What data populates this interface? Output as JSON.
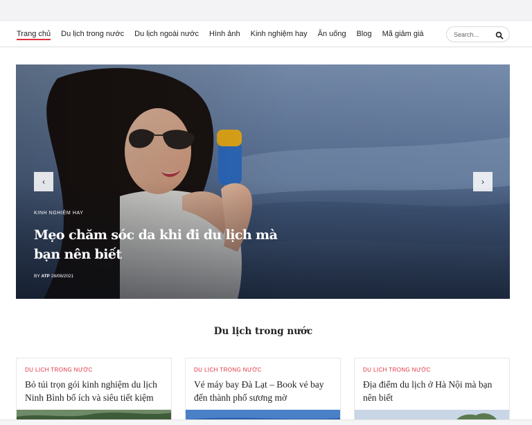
{
  "nav": {
    "items": [
      {
        "label": "Trang chủ",
        "active": true
      },
      {
        "label": "Du lịch trong nước",
        "active": false
      },
      {
        "label": "Du lịch ngoài nước",
        "active": false
      },
      {
        "label": "Hình ảnh",
        "active": false
      },
      {
        "label": "Kinh nghiệm hay",
        "active": false
      },
      {
        "label": "Ăn uống",
        "active": false
      },
      {
        "label": "Blog",
        "active": false
      },
      {
        "label": "Mã giảm giá",
        "active": false
      }
    ],
    "search_placeholder": "Search...",
    "search_icon": "search-icon"
  },
  "hero": {
    "category": "Kinh nghiệm hay",
    "title": "Mẹo chăm sóc da khi đi du lịch mà bạn nên biết",
    "author_prefix": "BY",
    "author": "ATP",
    "date": "28/08/2021",
    "prev_symbol": "‹",
    "next_symbol": "›"
  },
  "section": {
    "title": "Du lịch trong nước"
  },
  "cards": [
    {
      "category": "Du lịch trong nước",
      "title": "Bỏ túi trọn gói kinh nghiệm du lịch Ninh Bình bổ ích và siêu tiết kiệm"
    },
    {
      "category": "Du lịch trong nước",
      "title": "Vé máy bay Đà Lạt – Book vé bay đến thành phố sương mờ"
    },
    {
      "category": "Du lịch trong nước",
      "title": "Địa điểm du lịch ở Hà Nội mà bạn nên biết"
    }
  ],
  "colors": {
    "accent": "#e0303f",
    "text": "#222222"
  }
}
